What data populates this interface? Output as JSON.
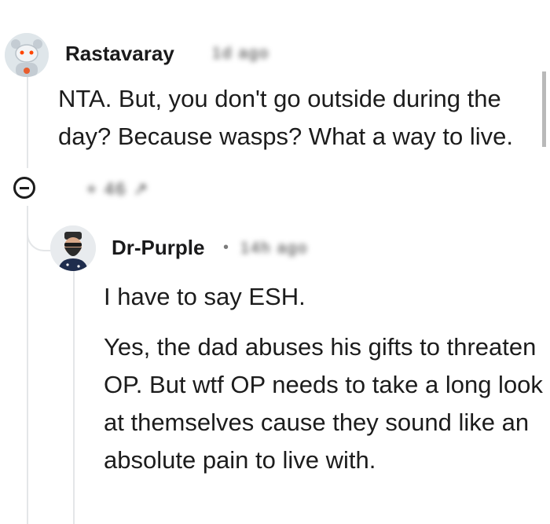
{
  "comments": [
    {
      "username": "Rastavaray",
      "meta": "1d ago",
      "body": "NTA. But, you don't go outside during the day? Because wasps? What a way to live."
    },
    {
      "username": "Dr-Purple",
      "separator": "•",
      "meta": "14h ago",
      "paragraphs": [
        "I have to say ESH.",
        "Yes, the dad abuses his gifts to threaten OP. But wtf OP needs to take a long look at themselves cause they sound like an absolute pain to live with."
      ]
    }
  ],
  "actions": {
    "votes": "+ 46 ↗"
  },
  "icons": [
    "snoo-avatar-icon",
    "bearded-avatar-icon",
    "collapse-minus-icon"
  ]
}
